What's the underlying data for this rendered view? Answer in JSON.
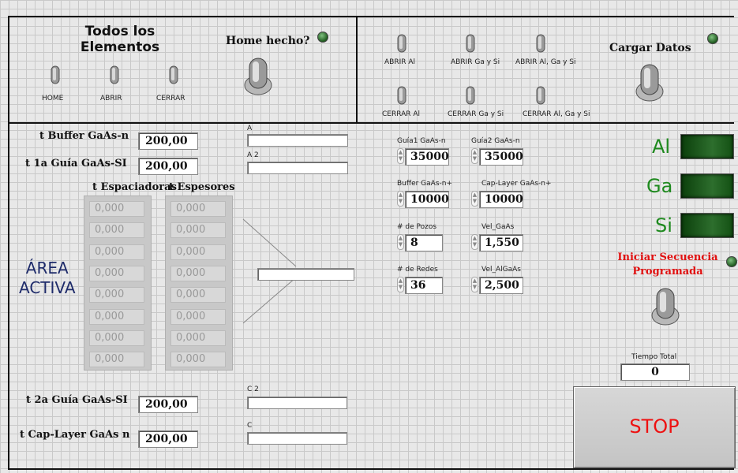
{
  "top_left": {
    "title_line1": "Todos los",
    "title_line2": "Elementos",
    "switches": [
      "HOME",
      "ABRIR",
      "CERRAR"
    ],
    "home_label": "Home hecho?"
  },
  "top_right": {
    "switches_row1": [
      "ABRIR Al",
      "ABRIR Ga y Si",
      "ABRIR Al, Ga y Si"
    ],
    "switches_row2": [
      "CERRAR Al",
      "CERRAR Ga y Si",
      "CERRAR Al, Ga y Si"
    ],
    "cargar_label": "Cargar Datos"
  },
  "left": {
    "t_buffer_label": "t Buffer GaAs-n",
    "t_buffer_value": "200,00",
    "t_1a_guia_label": "t 1a Guía GaAs-SI",
    "t_1a_guia_value": "200,00",
    "str_a_label": "A",
    "str_a2_label": "A 2",
    "espaciadoras_label": "t Espaciadoras",
    "espesores_label": "t Espesores",
    "espaciadoras": [
      "0,000",
      "0,000",
      "0,000",
      "0,000",
      "0,000",
      "0,000",
      "0,000",
      "0,000"
    ],
    "espesores": [
      "0,000",
      "0,000",
      "0,000",
      "0,000",
      "0,000",
      "0,000",
      "0,000",
      "0,000"
    ],
    "area_line1": "ÁREA",
    "area_line2": "ACTIVA",
    "t_2a_guia_label": "t 2a Guía GaAs-SI",
    "t_2a_guia_value": "200,00",
    "t_cap_label": "t Cap-Layer GaAs n",
    "t_cap_value": "200,00",
    "str_c2_label": "C 2",
    "str_c_label": "C"
  },
  "params": [
    {
      "label": "Guía1 GaAs-n",
      "value": "35000"
    },
    {
      "label": "Guía2 GaAs-n",
      "value": "35000"
    },
    {
      "label": "Buffer GaAs-n+",
      "value": "10000"
    },
    {
      "label": "Cap-Layer GaAs-n+",
      "value": "10000"
    },
    {
      "label": "# de Pozos",
      "value": "8"
    },
    {
      "label": "Vel_GaAs",
      "value": "1,550"
    },
    {
      "label": "# de Redes",
      "value": "36"
    },
    {
      "label": "Vel_AlGaAs",
      "value": "2,500"
    }
  ],
  "leds": [
    "Al",
    "Ga",
    "Si"
  ],
  "iniciar_line1": "Iniciar Secuencia",
  "iniciar_line2": "Programada",
  "tiempo_label": "Tiempo Total",
  "tiempo_value": "0",
  "stop_label": "STOP",
  "colors": {
    "led_green": "#2d6e2d",
    "stop_text": "#e11111",
    "iniciar_text": "#e11111"
  }
}
